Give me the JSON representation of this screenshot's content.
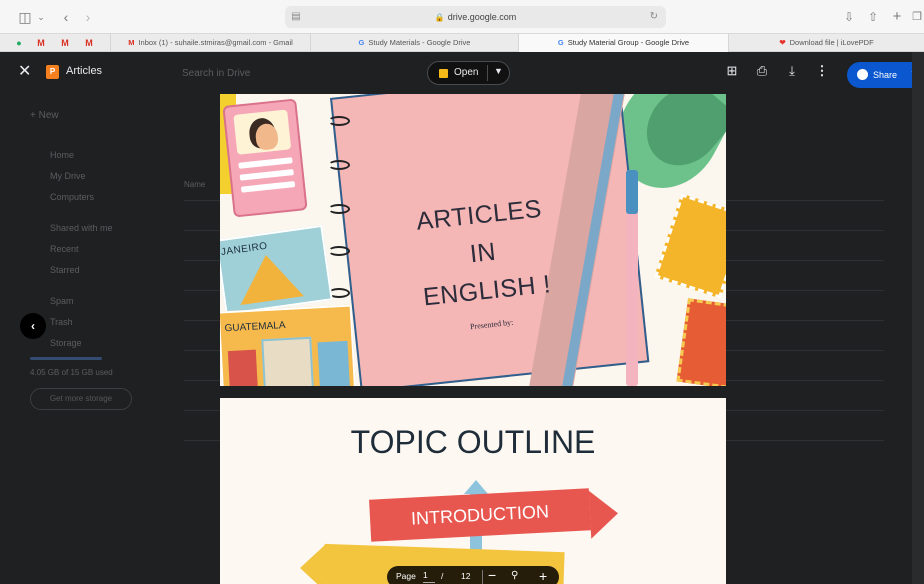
{
  "browser": {
    "address": "drive.google.com",
    "tabs": [
      {
        "label": "Inbox (1) - suhaile.stmiras@gmail.com - Gmail"
      },
      {
        "label": "Study Materials - Google Drive"
      },
      {
        "label": "Study Material Group - Google Drive"
      },
      {
        "label": "Download file | iLovePDF"
      }
    ]
  },
  "drive_background": {
    "search_placeholder": "Search in Drive",
    "new_label": "New",
    "nav": [
      "Home",
      "My Drive",
      "Computers",
      "Shared with me",
      "Recent",
      "Starred",
      "Spam",
      "Trash",
      "Storage"
    ],
    "storage_text": "4.05 GB of 15 GB used",
    "storage_button": "Get more storage",
    "name_header": "Name"
  },
  "viewer": {
    "file_title": "Articles",
    "open_label": "Open",
    "share_label": "Share"
  },
  "slide1": {
    "title_lines": [
      "ARTICLES",
      "IN",
      "ENGLISH !"
    ],
    "subtitle": "Presented by:",
    "card1": "JANEIRO",
    "card2": "GUATEMALA"
  },
  "slide2": {
    "title": "TOPIC OUTLINE",
    "sign1": "INTRODUCTION"
  },
  "page_nav": {
    "label": "Page",
    "current": "1",
    "slash": "/",
    "total": "12"
  }
}
